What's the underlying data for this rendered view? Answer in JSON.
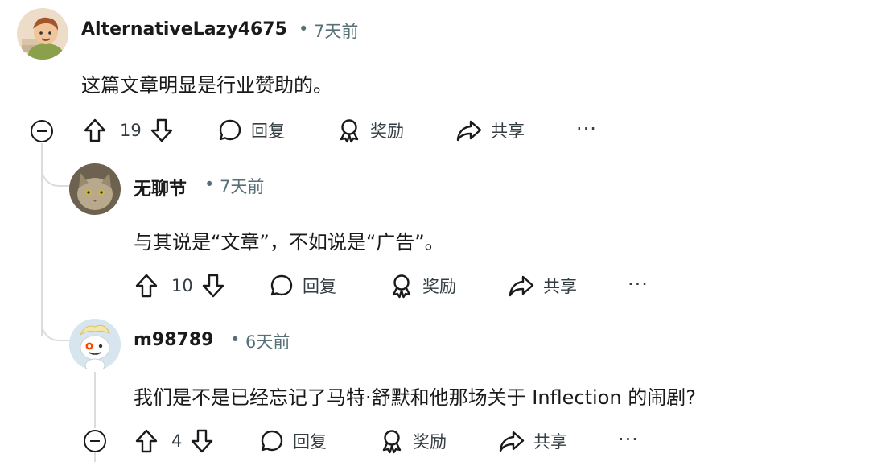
{
  "comments": [
    {
      "username": "AlternativeLazy4675",
      "time": "7天前",
      "body": "这篇文章明显是行业赞助的。",
      "votes": "19",
      "reply_label": "回复",
      "award_label": "奖励",
      "share_label": "共享",
      "more_label": "···"
    },
    {
      "username": "无聊节",
      "time": "7天前",
      "body": "与其说是“文章”，不如说是“广告”。",
      "votes": "10",
      "reply_label": "回复",
      "award_label": "奖励",
      "share_label": "共享",
      "more_label": "···"
    },
    {
      "username": "m98789",
      "time": "6天前",
      "body": "我们是不是已经忘记了马特·舒默和他那场关于 Inflection 的闹剧?",
      "votes": "4",
      "reply_label": "回复",
      "award_label": "奖励",
      "share_label": "共享",
      "more_label": "···"
    }
  ],
  "meta_separator": "•",
  "colors": {
    "text": "#1a1a1b",
    "meta": "#576f76",
    "thread_line": "#d9dde0"
  }
}
